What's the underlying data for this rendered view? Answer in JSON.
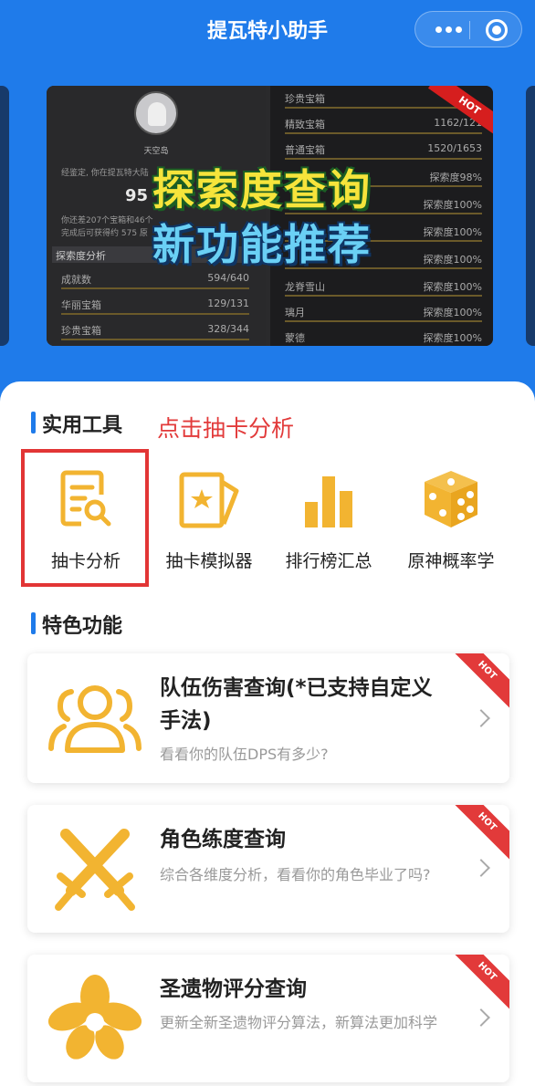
{
  "header": {
    "title": "提瓦特小助手"
  },
  "banner": {
    "badge": "HOT",
    "headline_1": "探索度查询",
    "headline_2": "新功能推荐",
    "left_panel": {
      "name": "天空岛",
      "line1": "经鉴定, 你在提瓦特大陆",
      "score": "95",
      "line2": "你还差207个宝箱和46个",
      "line3": "完成后可获得约 575 原",
      "header": "探索度分析",
      "rows": [
        {
          "label": "成就数",
          "value": "594/640"
        },
        {
          "label": "华丽宝箱",
          "value": "129/131"
        },
        {
          "label": "珍贵宝箱",
          "value": "328/344"
        }
      ]
    },
    "right_panel": {
      "rows": [
        {
          "label": "珍贵宝箱",
          "value": ""
        },
        {
          "label": "精致宝箱",
          "value": "1162/121"
        },
        {
          "label": "普通宝箱",
          "value": "1520/1653"
        },
        {
          "label": "",
          "value": "探索度98%"
        },
        {
          "label": "",
          "value": "探索度100%"
        },
        {
          "label": "",
          "value": "探索度100%"
        },
        {
          "label": "",
          "value": "探索度100%"
        },
        {
          "label": "龙脊雪山",
          "value": "探索度100%"
        },
        {
          "label": "璃月",
          "value": "探索度100%"
        },
        {
          "label": "蒙德",
          "value": "探索度100%"
        }
      ]
    }
  },
  "tools_section": {
    "title": "实用工具",
    "hint": "点击抽卡分析",
    "items": [
      {
        "label": "抽卡分析",
        "icon": "document-search-icon"
      },
      {
        "label": "抽卡模拟器",
        "icon": "card-star-icon"
      },
      {
        "label": "排行榜汇总",
        "icon": "bar-chart-icon"
      },
      {
        "label": "原神概率学",
        "icon": "dice-icon"
      }
    ]
  },
  "features_section": {
    "title": "特色功能",
    "cards": [
      {
        "title": "队伍伤害查询(*已支持自定义手法)",
        "desc": "看看你的队伍DPS有多少?",
        "badge": "HOT",
        "icon": "team-icon"
      },
      {
        "title": "角色练度查询",
        "desc": "综合各维度分析，看看你的角色毕业了吗?",
        "badge": "HOT",
        "icon": "crossed-swords-icon"
      },
      {
        "title": "圣遗物评分查询",
        "desc": "更新全新圣遗物评分算法，新算法更加科学",
        "badge": "HOT",
        "icon": "flower-icon"
      }
    ]
  },
  "colors": {
    "brand_blue": "#1f7bea",
    "accent_gold": "#f2b431",
    "hint_red": "#e23a3a"
  }
}
